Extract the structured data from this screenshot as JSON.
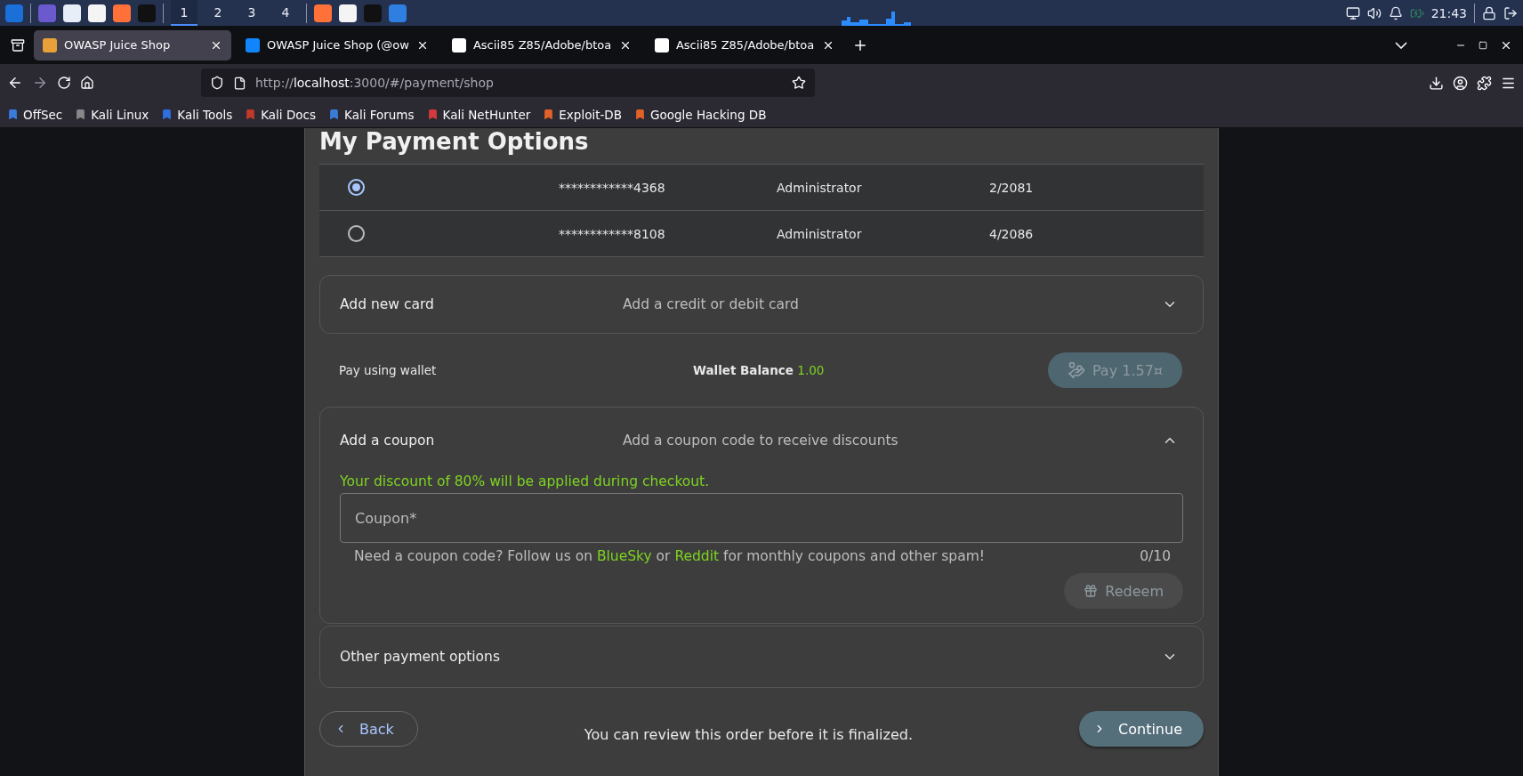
{
  "taskbar": {
    "workspaces": [
      {
        "label": "1",
        "selected": true
      },
      {
        "label": "2",
        "selected": false
      },
      {
        "label": "3",
        "selected": false
      },
      {
        "label": "4",
        "selected": false
      }
    ],
    "clock": "21:43"
  },
  "browser": {
    "tabs": [
      {
        "title": "OWASP Juice Shop",
        "selected": true,
        "kind": "juice"
      },
      {
        "title": "OWASP Juice Shop (@ow",
        "selected": false,
        "kind": "butterfly"
      },
      {
        "title": "Ascii85 Z85/Adobe/btoa",
        "selected": false,
        "kind": "cross"
      },
      {
        "title": "Ascii85 Z85/Adobe/btoa",
        "selected": false,
        "kind": "cross"
      }
    ],
    "url": {
      "scheme": "http://",
      "host": "localhost",
      "rest": ":3000/#/payment/shop"
    },
    "bookmarks": [
      "OffSec",
      "Kali Linux",
      "Kali Tools",
      "Kali Docs",
      "Kali Forums",
      "Kali NetHunter",
      "Exploit-DB",
      "Google Hacking DB"
    ]
  },
  "page": {
    "heading": "My Payment Options",
    "cards": [
      {
        "selected": true,
        "number": "************4368",
        "name": "Administrator",
        "expiry": "2/2081"
      },
      {
        "selected": false,
        "number": "************8108",
        "name": "Administrator",
        "expiry": "4/2086"
      }
    ],
    "add_card": {
      "title": "Add new card",
      "description": "Add a credit or debit card",
      "expanded": false
    },
    "wallet": {
      "label": "Pay using wallet",
      "balance_label": "Wallet Balance",
      "balance": "1.00",
      "pay_button": "Pay 1.57¤",
      "pay_disabled": true
    },
    "coupon": {
      "title": "Add a coupon",
      "description": "Add a coupon code to receive discounts",
      "expanded": true,
      "success": "Your discount of 80% will be applied during checkout.",
      "placeholder": "Coupon*",
      "hint": [
        {
          "kind": "text",
          "text": "Need a coupon code? Follow us on"
        },
        {
          "kind": "link",
          "text": "BlueSky"
        },
        {
          "kind": "text",
          "text": "or"
        },
        {
          "kind": "link",
          "text": "Reddit"
        },
        {
          "kind": "text",
          "text": "for monthly coupons and other spam!"
        }
      ],
      "counter": "0/10",
      "redeem_button": "Redeem",
      "redeem_disabled": true
    },
    "other": {
      "title": "Other payment options",
      "expanded": false
    },
    "footer": {
      "back": "Back",
      "note": "You can review this order before it is finalized.",
      "continue": "Continue"
    }
  }
}
